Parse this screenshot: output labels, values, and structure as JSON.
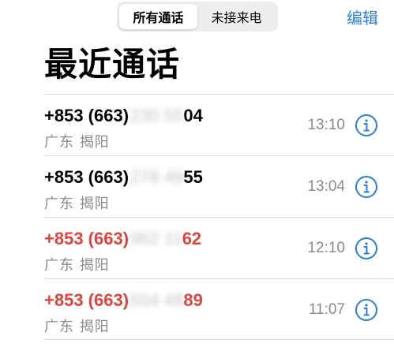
{
  "segmented": {
    "all_calls": "所有通话",
    "missed_calls": "未接来电"
  },
  "header": {
    "edit_label": "编辑",
    "title": "最近通话"
  },
  "calls": [
    {
      "prefix": "+853 (663)",
      "hidden": "230 55",
      "suffix": "04",
      "location": "广东 揭阳",
      "time": "13:10",
      "missed": false
    },
    {
      "prefix": "+853 (663)",
      "hidden": "278 49",
      "suffix": "55",
      "location": "广东 揭阳",
      "time": "13:04",
      "missed": false
    },
    {
      "prefix": "+853 (663)",
      "hidden": "962 11",
      "suffix": "62",
      "location": "广东 揭阳",
      "time": "12:10",
      "missed": true
    },
    {
      "prefix": "+853 (663)",
      "hidden": "554 48",
      "suffix": "89",
      "location": "广东 揭阳",
      "time": "11:07",
      "missed": true
    }
  ],
  "colors": {
    "accent": "#2b7de1",
    "missed": "#e0433e",
    "secondary_text": "#8a8a8e"
  },
  "icons": {
    "info": "info-circle-icon"
  }
}
